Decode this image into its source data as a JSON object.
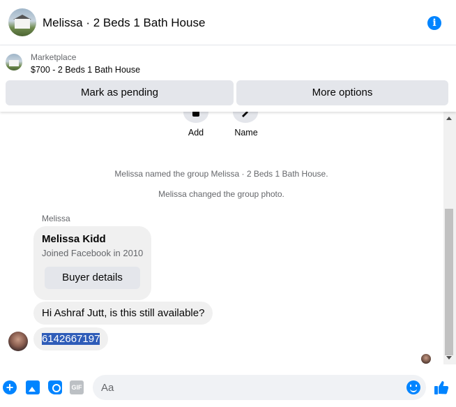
{
  "header": {
    "title": "Melissa · 2 Beds 1 Bath House",
    "info_icon": "info-icon",
    "accent_color": "#0084ff"
  },
  "listing": {
    "source": "Marketplace",
    "title": "$700 - 2 Beds 1 Bath House",
    "buttons": {
      "mark_pending": "Mark as pending",
      "more_options": "More options"
    }
  },
  "chat": {
    "actions": {
      "add_label": "Add",
      "name_label": "Name"
    },
    "system_messages": [
      "Melissa named the group Melissa · 2 Beds 1 Bath House.",
      "Melissa changed the group photo."
    ],
    "sender": "Melissa",
    "profile_card": {
      "name": "Melissa Kidd",
      "subtitle": "Joined Facebook in 2010",
      "button": "Buyer details"
    },
    "messages": [
      "Hi Ashraf Jutt, is this still available?",
      "6142667197"
    ]
  },
  "composer": {
    "placeholder": "Aa",
    "icons": [
      "plus-icon",
      "photo-icon",
      "sticker-icon",
      "gif-icon",
      "emoji-icon",
      "like-icon"
    ],
    "gif_label": "GIF"
  }
}
